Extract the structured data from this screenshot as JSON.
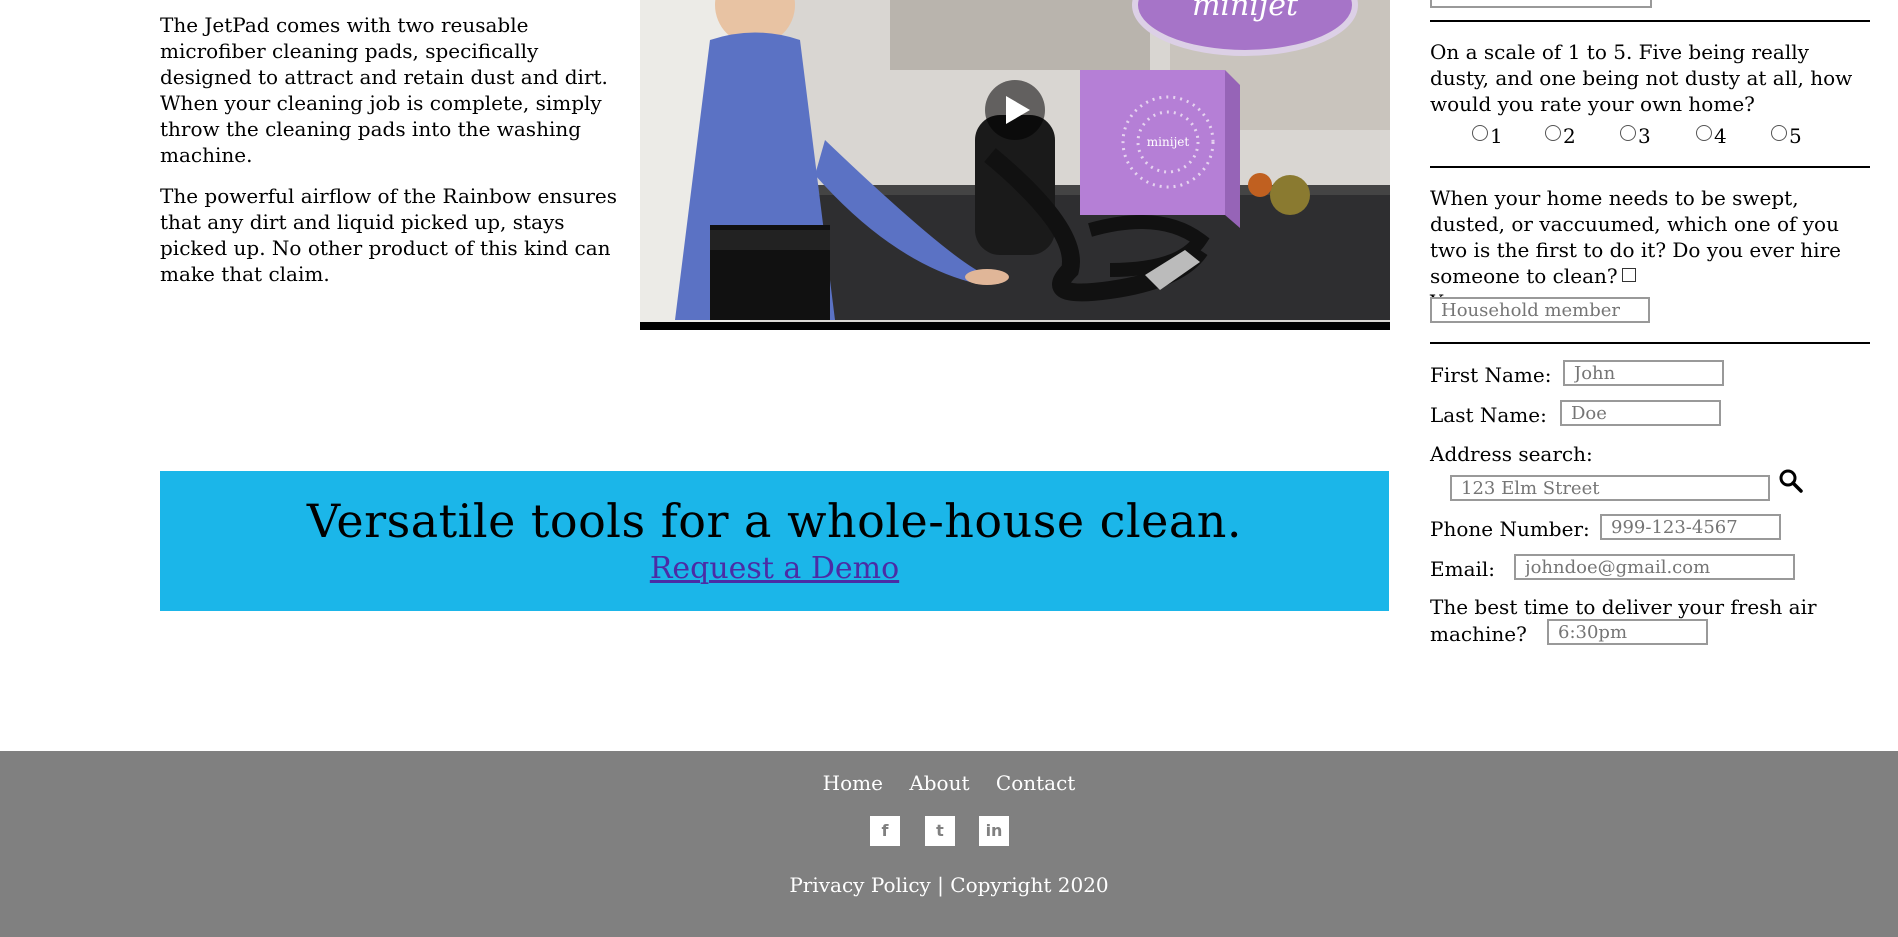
{
  "left_text": {
    "paragraph_1": "The JetPad comes with two reusable microfiber cleaning pads, specifically designed to attract and retain dust and dirt. When your cleaning job is complete, simply throw the cleaning pads into the washing machine.",
    "paragraph_2": "The powerful airflow of the Rainbow ensures that any dirt and liquid picked up, stays picked up. No other product of this kind can make that claim."
  },
  "video": {
    "brand_text": "minijet",
    "box_text": "minijet",
    "play_icon": "play-icon"
  },
  "banner": {
    "headline": "Versatile tools for a whole-house clean.",
    "link": "Request a Demo",
    "background": "#1bb6e9"
  },
  "form": {
    "dust_question": "On a scale of 1 to 5. Five being really dusty, and one being not dusty at all, how would you rate your own home?",
    "dust_options": [
      "1",
      "2",
      "3",
      "4",
      "5"
    ],
    "clean_question": "When your home needs to be swept, dusted, or vaccuumed, which one of you two is the first to do it? Do you ever hire someone to clean?",
    "hire_yes_label": "Yes",
    "household_placeholder": "Household member",
    "first_name_label": "First Name:",
    "first_name_placeholder": "John",
    "last_name_label": "Last Name:",
    "last_name_placeholder": "Doe",
    "address_label": "Address search:",
    "address_placeholder": "123 Elm Street",
    "phone_label": "Phone Number:",
    "phone_placeholder": "999-123-4567",
    "email_label": "Email:",
    "email_placeholder": "johndoe@gmail.com",
    "delivery_label_1": "The best time to deliver your fresh air",
    "delivery_label_2": "machine?",
    "delivery_placeholder": "6:30pm"
  },
  "footer": {
    "nav": [
      "Home",
      "About",
      "Contact"
    ],
    "social_icons": [
      "facebook-icon",
      "twitter-icon",
      "linkedin-icon"
    ],
    "social_glyphs": [
      "f",
      "t",
      "in"
    ],
    "copyright": "Privacy Policy | Copyright 2020",
    "background": "#808080"
  }
}
